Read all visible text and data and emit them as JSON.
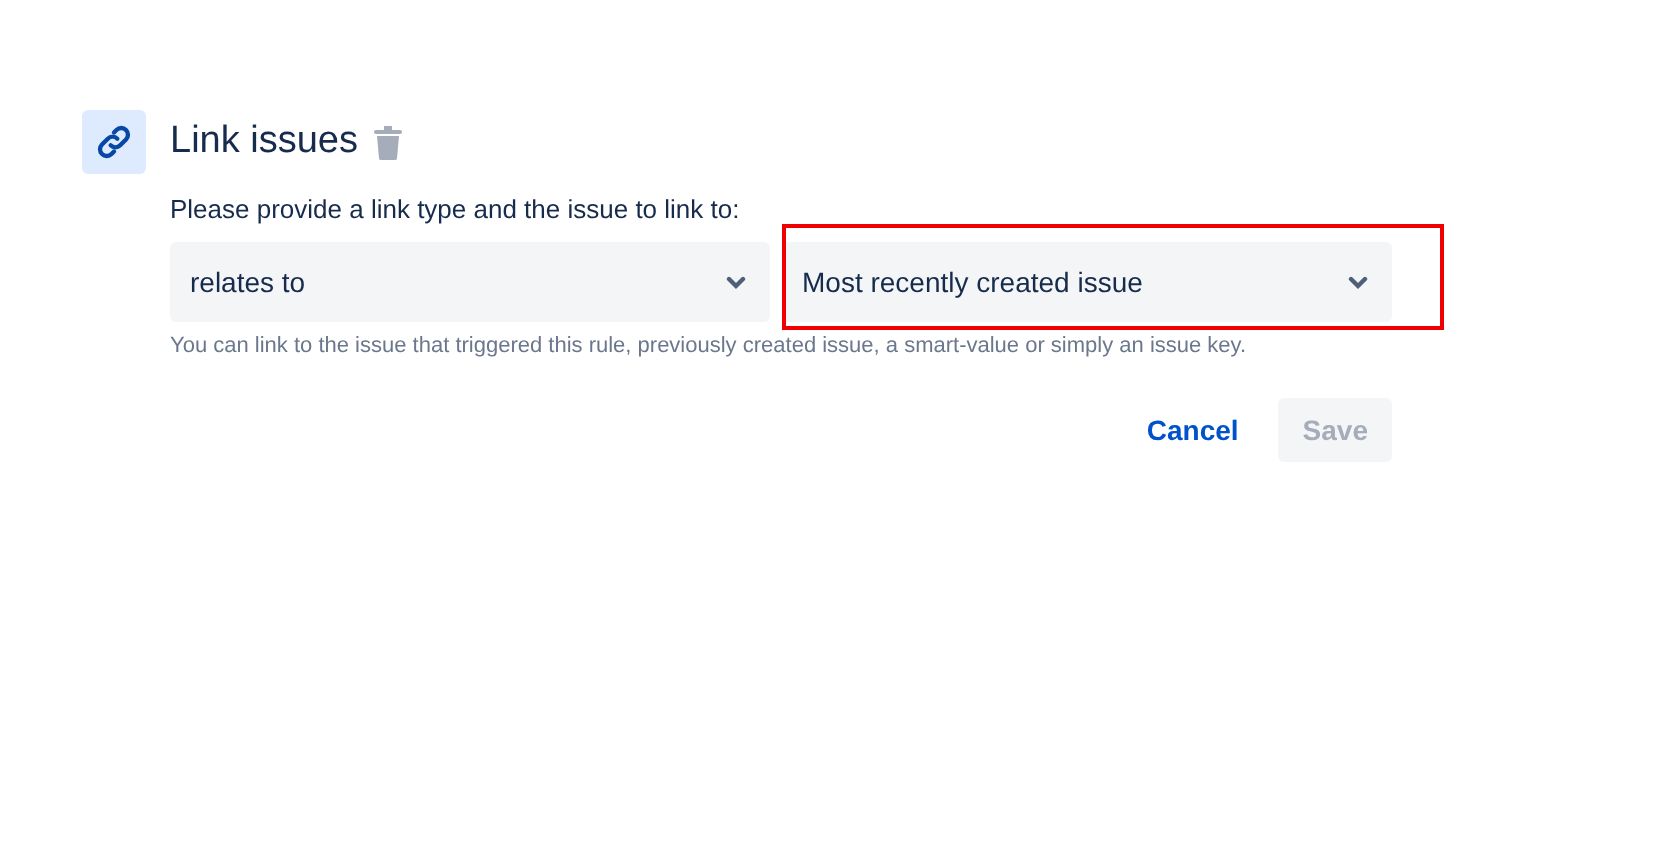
{
  "header": {
    "title": "Link issues"
  },
  "instruction": "Please provide a link type and the issue to link to:",
  "selects": [
    {
      "value": "relates to",
      "highlighted": false
    },
    {
      "value": "Most recently created issue",
      "highlighted": true
    }
  ],
  "helper_text": "You can link to the issue that triggered this rule, previously created issue, a smart-value or simply an issue key.",
  "buttons": [
    {
      "label": "Cancel",
      "kind": "link",
      "disabled": false
    },
    {
      "label": "Save",
      "kind": "primary",
      "disabled": true
    }
  ]
}
